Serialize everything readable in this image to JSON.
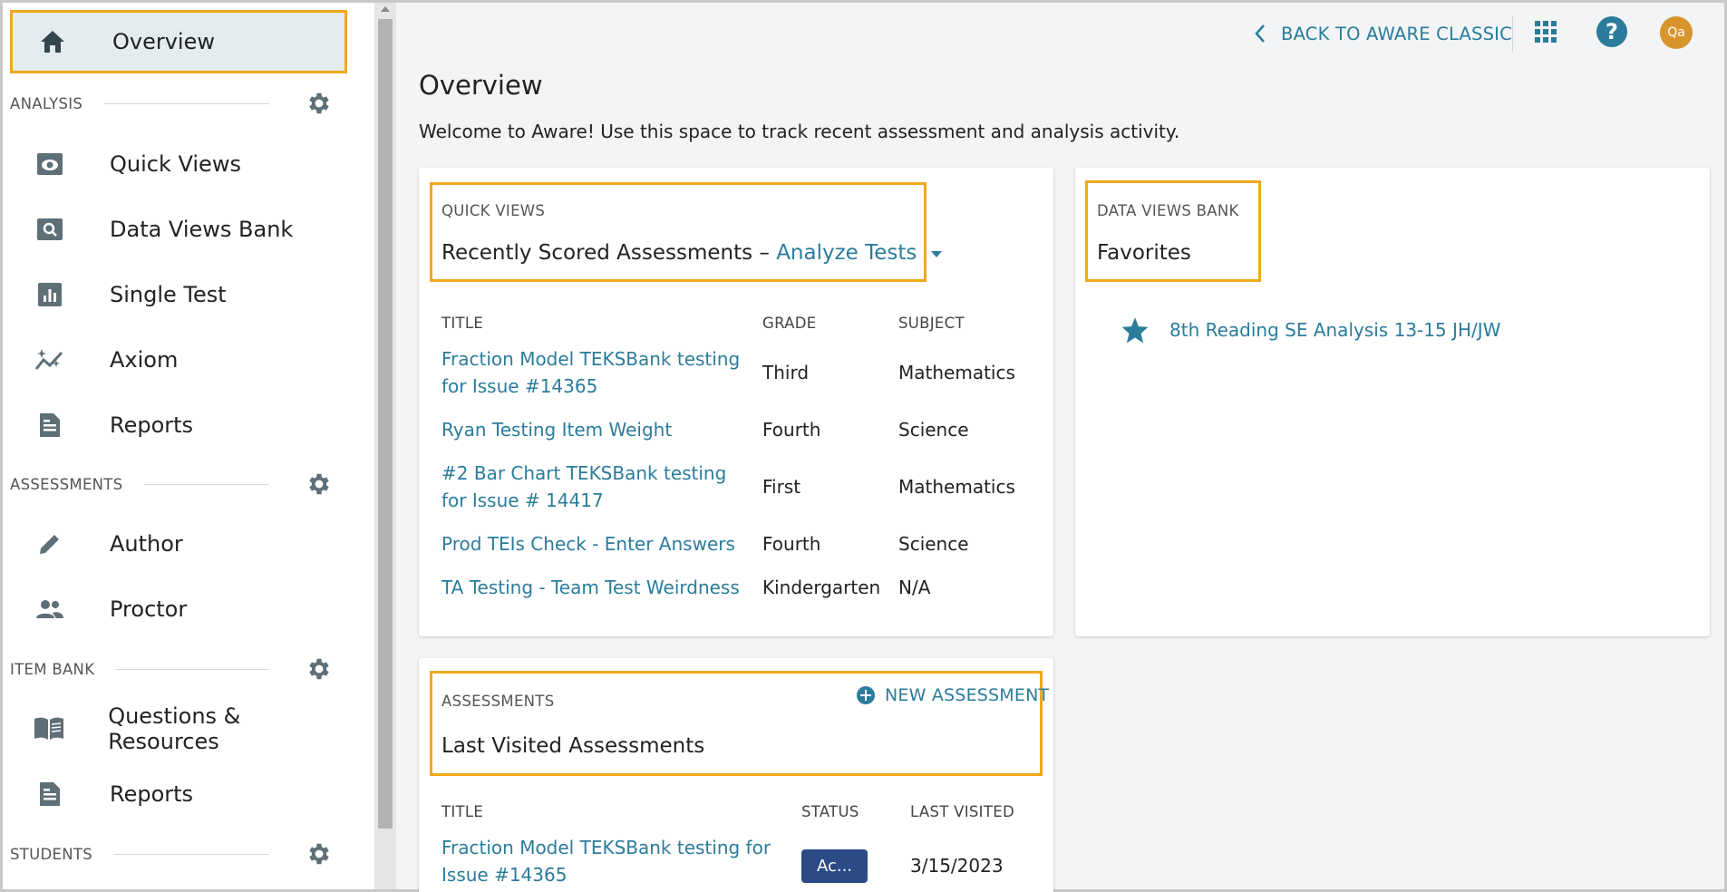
{
  "sidebar": {
    "overview": "Overview",
    "analysis": {
      "title": "ANALYSIS",
      "items": [
        "Quick Views",
        "Data Views Bank",
        "Single Test",
        "Axiom",
        "Reports"
      ]
    },
    "assessments": {
      "title": "ASSESSMENTS",
      "items": [
        "Author",
        "Proctor"
      ]
    },
    "item_bank": {
      "title": "ITEM BANK",
      "items": [
        "Questions & Resources",
        "Reports"
      ]
    },
    "students": {
      "title": "STUDENTS"
    }
  },
  "topbar": {
    "back_label": "BACK TO AWARE CLASSIC",
    "help_label": "?",
    "avatar_initials": "Qa"
  },
  "main": {
    "title": "Overview",
    "welcome": "Welcome to Aware! Use this space to track recent assessment and analysis activity."
  },
  "quick_views": {
    "kicker": "QUICK VIEWS",
    "title": "Recently Scored Assessments –",
    "dropdown_value": "Analyze Tests",
    "columns": [
      "TITLE",
      "GRADE",
      "SUBJECT"
    ],
    "rows": [
      {
        "title": "Fraction Model TEKSBank testing for Issue #14365",
        "grade": "Third",
        "subject": "Mathematics"
      },
      {
        "title": "Ryan Testing Item Weight",
        "grade": "Fourth",
        "subject": "Science"
      },
      {
        "title": "#2 Bar Chart TEKSBank testing for Issue # 14417",
        "grade": "First",
        "subject": "Mathematics"
      },
      {
        "title": "Prod TEIs Check - Enter Answers",
        "grade": "Fourth",
        "subject": "Science"
      },
      {
        "title": "TA Testing - Team Test Weirdness",
        "grade": "Kindergarten",
        "subject": "N/A"
      }
    ]
  },
  "data_views": {
    "kicker": "DATA VIEWS BANK",
    "title": "Favorites",
    "favorites": [
      "8th Reading SE Analysis 13-15 JH/JW"
    ]
  },
  "assessments_card": {
    "kicker": "ASSESSMENTS",
    "new_label": "NEW ASSESSMENT",
    "title": "Last Visited Assessments",
    "columns": [
      "TITLE",
      "STATUS",
      "LAST VISITED"
    ],
    "rows": [
      {
        "title": "Fraction Model TEKSBank testing for Issue #14365",
        "status": "Ac...",
        "last_visited": "3/15/2023"
      }
    ]
  },
  "colors": {
    "accent": "#2b7c9b",
    "highlight": "#f2a81d",
    "icon_gray": "#5f6f78",
    "status_pill": "#2c4a86",
    "avatar": "#d8952e"
  }
}
